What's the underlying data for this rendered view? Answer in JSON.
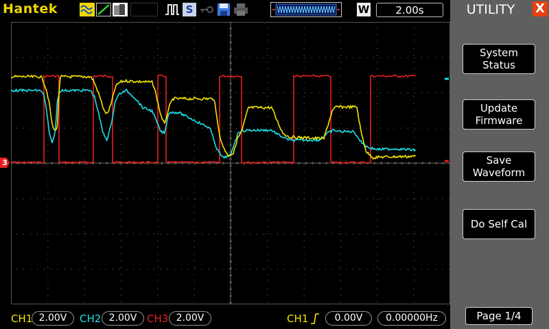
{
  "header": {
    "brand": "Hantek",
    "mode_icons": [
      "wave-icon",
      "ramp-icon",
      "grayscale-icon"
    ],
    "run_indicator": "pulse-icon",
    "save_indicator": "S",
    "timebase_mode": "W",
    "time_per_div": "2.00s"
  },
  "panel": {
    "title": "UTILITY",
    "close_label": "X",
    "buttons": [
      {
        "line1": "System",
        "line2": "Status"
      },
      {
        "line1": "Update",
        "line2": "Firmware"
      },
      {
        "line1": "Save",
        "line2": "Waveform"
      },
      {
        "line1": "Do Self Cal",
        "line2": ""
      }
    ],
    "page": "Page 1/4"
  },
  "channels": [
    {
      "label": "CH1",
      "scale": "2.00V",
      "color": "#f5e600"
    },
    {
      "label": "CH2",
      "scale": "2.00V",
      "color": "#1de0e8"
    },
    {
      "label": "CH3",
      "scale": "2.00V",
      "color": "#e82020"
    }
  ],
  "trigger": {
    "source": "CH1",
    "level": "0.00V",
    "frequency": "0.00000Hz"
  },
  "ch3_marker": "3",
  "colors": {
    "ch1": "#f5e600",
    "ch2": "#1de0e8",
    "ch3": "#e82020",
    "panel_bg": "#5f5f5f",
    "close_bg": "#e84010"
  }
}
